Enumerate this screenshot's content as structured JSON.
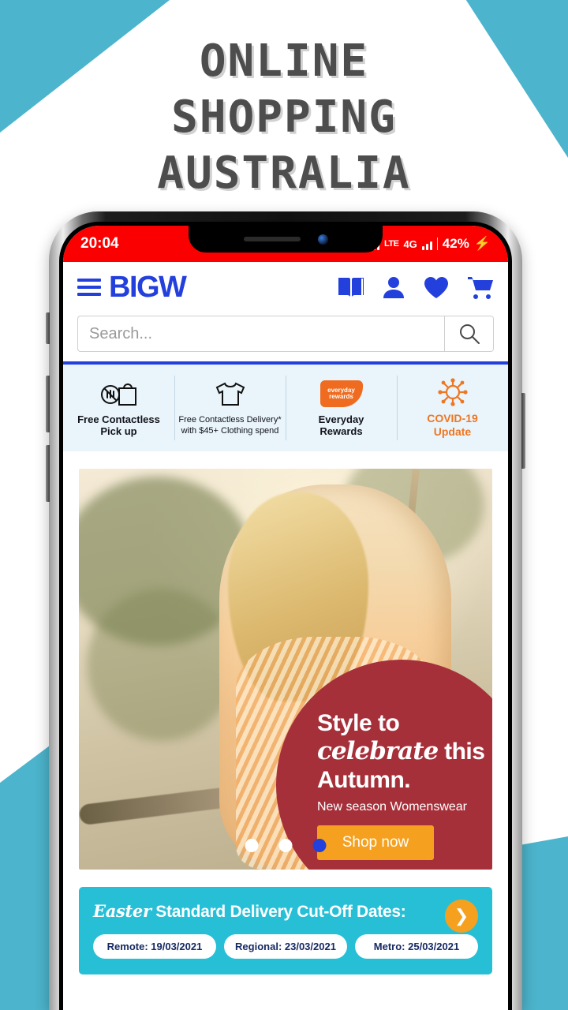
{
  "headline": {
    "line1": "ONLINE",
    "line2": "SHOPPING",
    "line3": "AUSTRALIA"
  },
  "colors": {
    "teal": "#4cb4cc",
    "brand_blue": "#2340dd",
    "status_red": "#fa0000",
    "promo_maroon": "#a6303a",
    "orange": "#f5a11f",
    "easter_cyan": "#27bfd6",
    "service_bg": "#e9f4fb"
  },
  "status_bar": {
    "time": "20:04",
    "network_label": "LTE",
    "data_label": "4G",
    "battery": "42%",
    "charging_icon": "lightning-bolt-icon"
  },
  "header": {
    "menu_icon": "hamburger-menu-icon",
    "logo": "BIGW",
    "icons": [
      {
        "name": "catalogue-icon",
        "label": "Catalogue"
      },
      {
        "name": "account-icon",
        "label": "Account"
      },
      {
        "name": "wishlist-heart-icon",
        "label": "Wishlist"
      },
      {
        "name": "cart-icon",
        "label": "Cart"
      }
    ]
  },
  "search": {
    "placeholder": "Search...",
    "value": "",
    "button_icon": "search-icon"
  },
  "services": [
    {
      "icon": "contactless-pickup-icon",
      "line1": "Free Contactless",
      "line2": "Pick up",
      "style": "normal"
    },
    {
      "icon": "tshirt-icon",
      "line1": "Free Contactless Delivery*",
      "line2": "with $45+ Clothing spend",
      "style": "small"
    },
    {
      "icon": "everyday-rewards-logo-icon",
      "badge_line1": "everyday",
      "badge_line2": "rewards",
      "line1": "Everyday",
      "line2": "Rewards",
      "style": "normal"
    },
    {
      "icon": "covid-virus-icon",
      "line1": "COVID-19",
      "line2": "Update",
      "style": "orange"
    }
  ],
  "hero": {
    "promo_line1": "Style to",
    "promo_script": "celebrate",
    "promo_line2_tail": " this",
    "promo_line3": "Autumn.",
    "promo_subtitle": "New season Womenswear",
    "cta_label": "Shop now",
    "carousel": {
      "total": 3,
      "active_index": 2
    }
  },
  "easter_banner": {
    "title_script": "Easter",
    "title_rest": " Standard Delivery Cut-Off Dates:",
    "arrow_icon": "chevron-right-icon",
    "pills": [
      "Remote: 19/03/2021",
      "Regional: 23/03/2021",
      "Metro: 25/03/2021"
    ]
  }
}
